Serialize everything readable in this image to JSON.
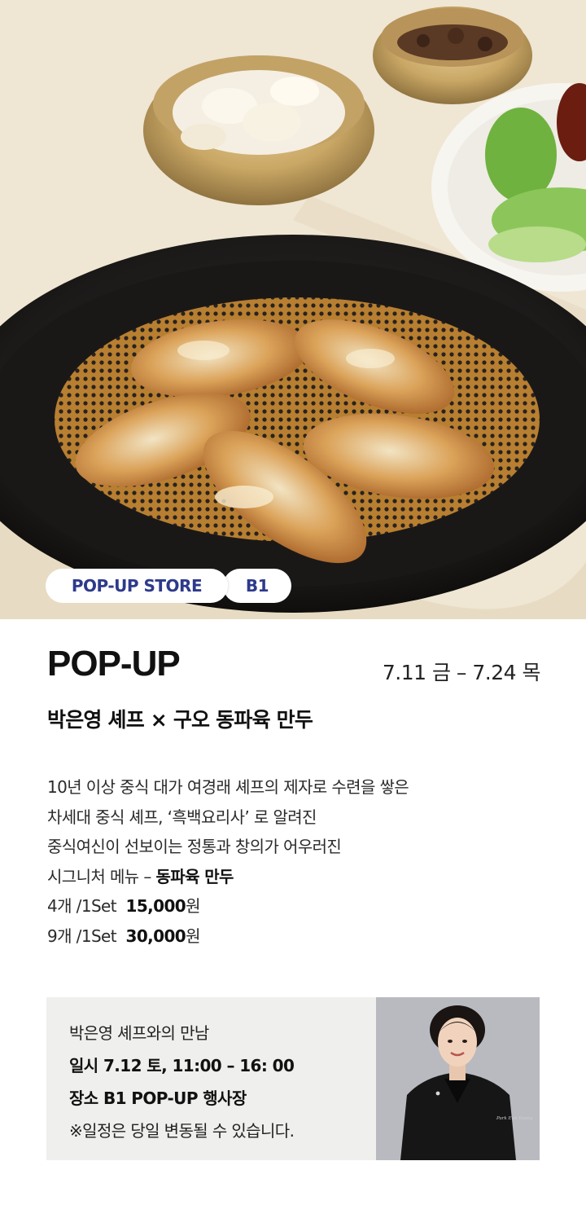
{
  "hero": {
    "chip_store": "POP-UP STORE",
    "chip_floor": "B1"
  },
  "event": {
    "title": "POP-UP",
    "dates": "7.11 금 – 7.24 목",
    "subtitle": "박은영 셰프 × 구오 동파육 만두"
  },
  "description": {
    "line1": "10년 이상 중식 대가 여경래 셰프의 제자로 수련을 쌓은",
    "line2": "차세대 중식 셰프, ‘흑백요리사’ 로 알려진",
    "line3": "중식여신이 선보이는 정통과 창의가 어우러진",
    "line4_prefix": "시그니처 메뉴 – ",
    "line4_menu": "동파육 만두"
  },
  "prices": [
    {
      "qty": "4개 /1Set",
      "amount": "15,000",
      "unit": "원"
    },
    {
      "qty": "9개 /1Set",
      "amount": "30,000",
      "unit": "원"
    }
  ],
  "meet": {
    "heading": "박은영 셰프와의 만남",
    "date_label": "일시",
    "date_value": "7.12 토, 11:00 – 16: 00",
    "place_label": "장소",
    "place_value": "B1 POP-UP 행사장",
    "notice": "※일정은 당일 변동될 수 있습니다.",
    "badge_text": "Park Eun Young"
  },
  "colors": {
    "chip_text": "#2d3a8c",
    "meet_bg": "#efefed",
    "plate": "#1f1d1c",
    "dumpling_gold": "#d7953a"
  }
}
